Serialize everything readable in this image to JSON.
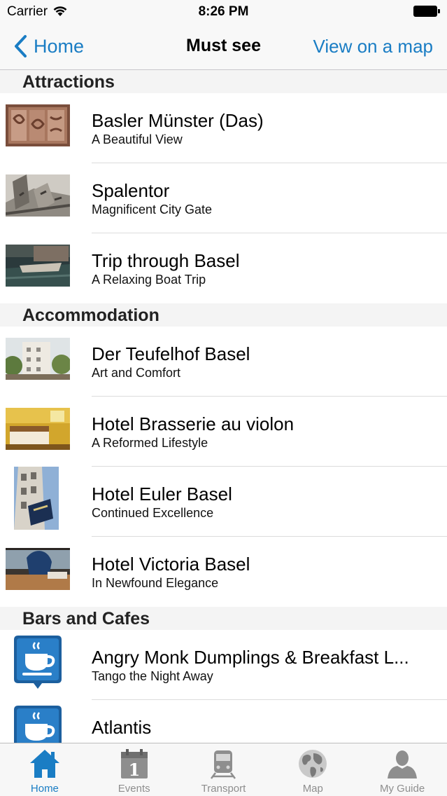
{
  "status_bar": {
    "carrier": "Carrier",
    "time": "8:26 PM"
  },
  "nav": {
    "back_label": "Home",
    "title": "Must see",
    "right_label": "View on a map"
  },
  "sections": [
    {
      "header": "Attractions",
      "items": [
        {
          "title": "Basler Münster (Das)",
          "subtitle": "A Beautiful View"
        },
        {
          "title": "Spalentor",
          "subtitle": "Magnificent City Gate"
        },
        {
          "title": "Trip through Basel",
          "subtitle": "A Relaxing Boat Trip"
        }
      ]
    },
    {
      "header": "Accommodation",
      "items": [
        {
          "title": "Der Teufelhof Basel",
          "subtitle": "Art and Comfort"
        },
        {
          "title": "Hotel Brasserie au violon",
          "subtitle": "A Reformed Lifestyle"
        },
        {
          "title": "Hotel Euler Basel",
          "subtitle": "Continued Excellence"
        },
        {
          "title": "Hotel Victoria Basel",
          "subtitle": "In Newfound Elegance"
        }
      ]
    },
    {
      "header": "Bars and Cafes",
      "items": [
        {
          "title": "Angry Monk Dumplings & Breakfast L...",
          "subtitle": "Tango the Night Away"
        },
        {
          "title": "Atlantis",
          "subtitle": ""
        }
      ]
    }
  ],
  "tabs": [
    {
      "label": "Home",
      "icon": "home-icon",
      "active": true
    },
    {
      "label": "Events",
      "icon": "calendar-icon",
      "active": false
    },
    {
      "label": "Transport",
      "icon": "train-icon",
      "active": false
    },
    {
      "label": "Map",
      "icon": "globe-icon",
      "active": false
    },
    {
      "label": "My Guide",
      "icon": "person-icon",
      "active": false
    }
  ],
  "colors": {
    "accent": "#1a7dc4",
    "tab_inactive": "#8e8e8e",
    "section_bg": "#f4f4f4"
  }
}
